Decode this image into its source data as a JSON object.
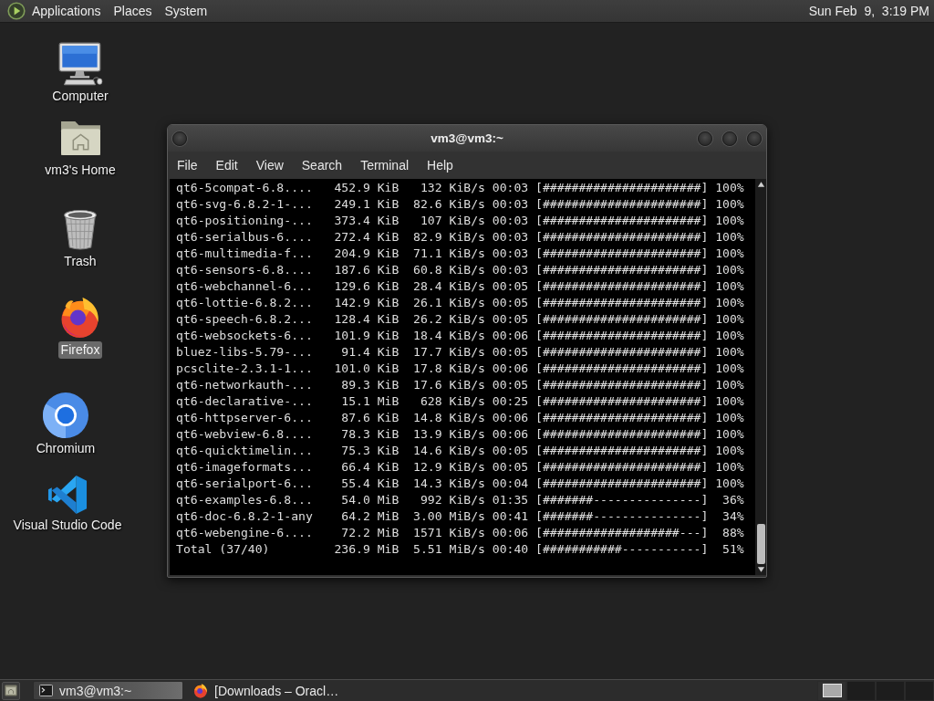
{
  "top_panel": {
    "menus": [
      "Applications",
      "Places",
      "System"
    ],
    "clock": "Sun Feb  9,  3:19 PM"
  },
  "desktop_icons": [
    {
      "label": "Computer",
      "kind": "computer",
      "selected": false
    },
    {
      "label": "vm3's Home",
      "kind": "home",
      "selected": false
    },
    {
      "label": "Trash",
      "kind": "trash",
      "selected": false
    },
    {
      "label": "Firefox",
      "kind": "firefox",
      "selected": true
    },
    {
      "label": "Chromium",
      "kind": "chromium",
      "selected": false
    },
    {
      "label": "Visual Studio Code",
      "kind": "vscode",
      "selected": false
    }
  ],
  "terminal": {
    "title": "vm3@vm3:~",
    "menu": [
      "File",
      "Edit",
      "View",
      "Search",
      "Terminal",
      "Help"
    ],
    "rows": [
      {
        "package": "qt6-5compat-6.8....",
        "size": "452.9 KiB",
        "rate": "132 KiB/s",
        "eta": "00:03",
        "bar": "[######################]",
        "percent": "100%"
      },
      {
        "package": "qt6-svg-6.8.2-1-...",
        "size": "249.1 KiB",
        "rate": "82.6 KiB/s",
        "eta": "00:03",
        "bar": "[######################]",
        "percent": "100%"
      },
      {
        "package": "qt6-positioning-...",
        "size": "373.4 KiB",
        "rate": "107 KiB/s",
        "eta": "00:03",
        "bar": "[######################]",
        "percent": "100%"
      },
      {
        "package": "qt6-serialbus-6....",
        "size": "272.4 KiB",
        "rate": "82.9 KiB/s",
        "eta": "00:03",
        "bar": "[######################]",
        "percent": "100%"
      },
      {
        "package": "qt6-multimedia-f...",
        "size": "204.9 KiB",
        "rate": "71.1 KiB/s",
        "eta": "00:03",
        "bar": "[######################]",
        "percent": "100%"
      },
      {
        "package": "qt6-sensors-6.8....",
        "size": "187.6 KiB",
        "rate": "60.8 KiB/s",
        "eta": "00:03",
        "bar": "[######################]",
        "percent": "100%"
      },
      {
        "package": "qt6-webchannel-6...",
        "size": "129.6 KiB",
        "rate": "28.4 KiB/s",
        "eta": "00:05",
        "bar": "[######################]",
        "percent": "100%"
      },
      {
        "package": "qt6-lottie-6.8.2...",
        "size": "142.9 KiB",
        "rate": "26.1 KiB/s",
        "eta": "00:05",
        "bar": "[######################]",
        "percent": "100%"
      },
      {
        "package": "qt6-speech-6.8.2...",
        "size": "128.4 KiB",
        "rate": "26.2 KiB/s",
        "eta": "00:05",
        "bar": "[######################]",
        "percent": "100%"
      },
      {
        "package": "qt6-websockets-6...",
        "size": "101.9 KiB",
        "rate": "18.4 KiB/s",
        "eta": "00:06",
        "bar": "[######################]",
        "percent": "100%"
      },
      {
        "package": "bluez-libs-5.79-...",
        "size": "91.4 KiB",
        "rate": "17.7 KiB/s",
        "eta": "00:05",
        "bar": "[######################]",
        "percent": "100%"
      },
      {
        "package": "pcsclite-2.3.1-1...",
        "size": "101.0 KiB",
        "rate": "17.8 KiB/s",
        "eta": "00:06",
        "bar": "[######################]",
        "percent": "100%"
      },
      {
        "package": "qt6-networkauth-...",
        "size": "89.3 KiB",
        "rate": "17.6 KiB/s",
        "eta": "00:05",
        "bar": "[######################]",
        "percent": "100%"
      },
      {
        "package": "qt6-declarative-...",
        "size": "15.1 MiB",
        "rate": "628 KiB/s",
        "eta": "00:25",
        "bar": "[######################]",
        "percent": "100%"
      },
      {
        "package": "qt6-httpserver-6...",
        "size": "87.6 KiB",
        "rate": "14.8 KiB/s",
        "eta": "00:06",
        "bar": "[######################]",
        "percent": "100%"
      },
      {
        "package": "qt6-webview-6.8....",
        "size": "78.3 KiB",
        "rate": "13.9 KiB/s",
        "eta": "00:06",
        "bar": "[######################]",
        "percent": "100%"
      },
      {
        "package": "qt6-quicktimelin...",
        "size": "75.3 KiB",
        "rate": "14.6 KiB/s",
        "eta": "00:05",
        "bar": "[######################]",
        "percent": "100%"
      },
      {
        "package": "qt6-imageformats...",
        "size": "66.4 KiB",
        "rate": "12.9 KiB/s",
        "eta": "00:05",
        "bar": "[######################]",
        "percent": "100%"
      },
      {
        "package": "qt6-serialport-6...",
        "size": "55.4 KiB",
        "rate": "14.3 KiB/s",
        "eta": "00:04",
        "bar": "[######################]",
        "percent": "100%"
      },
      {
        "package": "qt6-examples-6.8...",
        "size": "54.0 MiB",
        "rate": "992 KiB/s",
        "eta": "01:35",
        "bar": "[#######---------------]",
        "percent": "36%"
      },
      {
        "package": "qt6-doc-6.8.2-1-any",
        "size": "64.2 MiB",
        "rate": "3.00 MiB/s",
        "eta": "00:41",
        "bar": "[#######---------------]",
        "percent": "34%"
      },
      {
        "package": "qt6-webengine-6....",
        "size": "72.2 MiB",
        "rate": "1571 KiB/s",
        "eta": "00:06",
        "bar": "[###################---]",
        "percent": "88%"
      },
      {
        "package": "Total (37/40)",
        "size": "236.9 MiB",
        "rate": "5.51 MiB/s",
        "eta": "00:40",
        "bar": "[###########-----------]",
        "percent": "51%"
      }
    ]
  },
  "taskbar": {
    "tasks": [
      {
        "title": "vm3@vm3:~",
        "kind": "terminal",
        "selected": true
      },
      {
        "title": "[Downloads – Oracl…",
        "kind": "firefox",
        "selected": false
      }
    ],
    "workspaces": [
      {
        "selected": true
      },
      {
        "selected": false
      },
      {
        "selected": false
      },
      {
        "selected": false
      }
    ]
  }
}
